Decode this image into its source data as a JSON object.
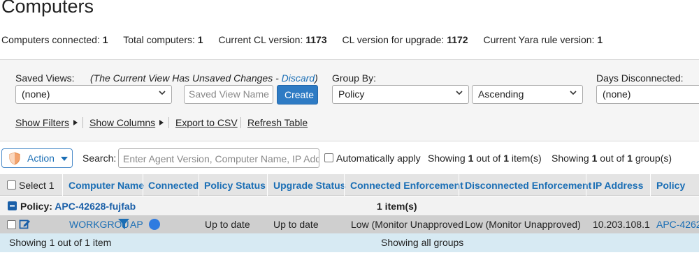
{
  "page": {
    "title": "Computers"
  },
  "stats": [
    {
      "label": "Computers connected:",
      "value": "1"
    },
    {
      "label": "Total computers:",
      "value": "1"
    },
    {
      "label": "Current CL version:",
      "value": "1173"
    },
    {
      "label": "CL version for upgrade:",
      "value": "1172"
    },
    {
      "label": "Current Yara rule version:",
      "value": "1"
    }
  ],
  "views": {
    "saved_views_label": "Saved Views:",
    "unsaved_prefix": "(The Current View Has Unsaved Changes - ",
    "discard_label": "Discard",
    "unsaved_suffix": ")",
    "saved_view_value": "(none)",
    "saved_view_name_placeholder": "Saved View Name",
    "create_label": "Create",
    "group_by_label": "Group By:",
    "group_by_value": "Policy",
    "order_value": "Ascending",
    "days_disconnected_label": "Days Disconnected:",
    "days_disconnected_value": "(none)"
  },
  "toolbar": {
    "show_filters": "Show Filters",
    "show_columns": "Show Columns",
    "export_csv": "Export to CSV",
    "refresh_table": "Refresh Table"
  },
  "actions": {
    "action_label": "Action",
    "search_label": "Search:",
    "search_placeholder": "Enter Agent Version, Computer Name, IP Address",
    "auto_apply_label": "Automatically apply",
    "showing_items_pre": "Showing ",
    "showing_items_count": "1",
    "showing_items_mid": " out of ",
    "showing_items_total": "1",
    "showing_items_suffix": " item(s)",
    "showing_groups_pre": "Showing ",
    "showing_groups_count": "1",
    "showing_groups_mid": " out of ",
    "showing_groups_total": "1",
    "showing_groups_suffix": " group(s)"
  },
  "table": {
    "select_label": "Select 1",
    "columns": [
      "Computer Name",
      "Connected",
      "Policy Status",
      "Upgrade Status",
      "Connected Enforcement",
      "Disconnected Enforcement",
      "IP Address",
      "Policy"
    ],
    "group": {
      "prefix": "Policy: ",
      "name": "APC-42628-fujfab",
      "count": "1 item(s)"
    },
    "row": {
      "computer_name": "WORKGROU",
      "computer_name_tail": "AP",
      "policy_status": "Up to date",
      "upgrade_status": "Up to date",
      "connected_enforcement": "Low (Monitor Unapproved",
      "disconnected_enforcement": "Low (Monitor Unapproved)",
      "ip_address": "10.203.108.1",
      "policy": "APC-4262"
    },
    "footer": {
      "left": "Showing 1 out of 1 item",
      "center": "Showing all groups"
    }
  },
  "colors": {
    "accent": "#1a6eb5",
    "button": "#2e7bc4",
    "header_bg": "#e4e4e4",
    "footer_bg": "#d7eaf3",
    "connected_dot": "#2f7be0",
    "shield": "#f2a470"
  }
}
